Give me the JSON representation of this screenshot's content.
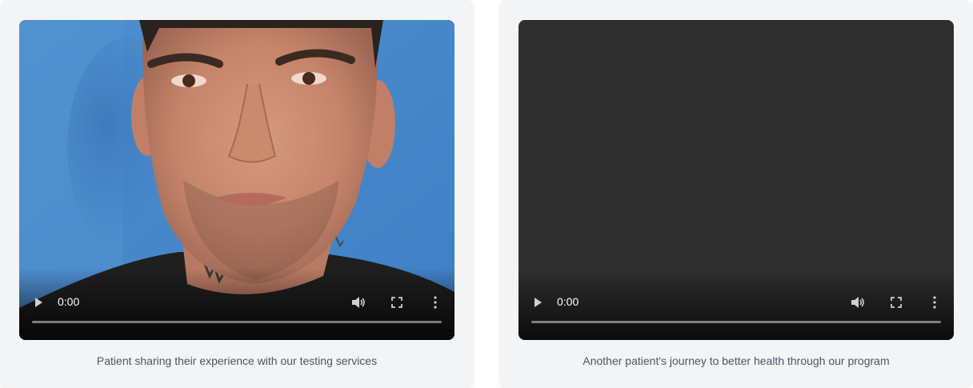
{
  "videos": [
    {
      "poster": "man-face-portrait",
      "time": "0:00",
      "progress": 0,
      "caption": "Patient sharing their experience with our testing services",
      "icons": {
        "play": "play-icon",
        "volume": "volume-icon",
        "fullscreen": "fullscreen-icon",
        "menu": "more-options-icon"
      }
    },
    {
      "poster": "none",
      "time": "0:00",
      "progress": 0,
      "caption": "Another patient's journey to better health through our program",
      "icons": {
        "play": "play-icon",
        "volume": "volume-icon",
        "fullscreen": "fullscreen-icon",
        "menu": "more-options-icon"
      }
    }
  ],
  "colors": {
    "card_bg": "#f3f4f6",
    "video_empty_bg": "#2f2f2f",
    "caption_text": "#4b5563"
  }
}
